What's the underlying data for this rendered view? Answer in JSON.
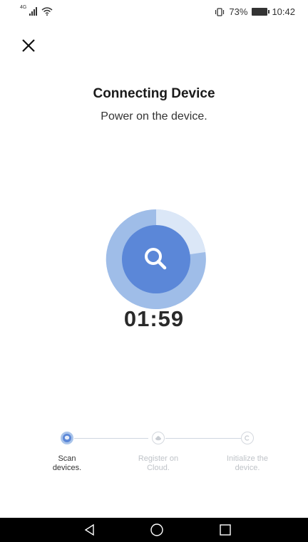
{
  "status_bar": {
    "network_label": "4G",
    "battery_percent": "73%",
    "time": "10:42"
  },
  "title": "Connecting Device",
  "subtitle": "Power on the device.",
  "timer": "01:59",
  "steps": [
    {
      "label_line1": "Scan",
      "label_line2": "devices.",
      "active": true
    },
    {
      "label_line1": "Register on",
      "label_line2": "Cloud.",
      "active": false
    },
    {
      "label_line1": "Initialize the",
      "label_line2": "device.",
      "active": false
    }
  ],
  "colors": {
    "accent": "#5b87d8",
    "ring_light": "#9fbde8",
    "inactive": "#bfc3c8"
  },
  "icons": {
    "close": "close-icon",
    "scan": "search-icon",
    "nav_back": "back-triangle-icon",
    "nav_home": "home-circle-icon",
    "nav_recents": "recents-square-icon"
  }
}
